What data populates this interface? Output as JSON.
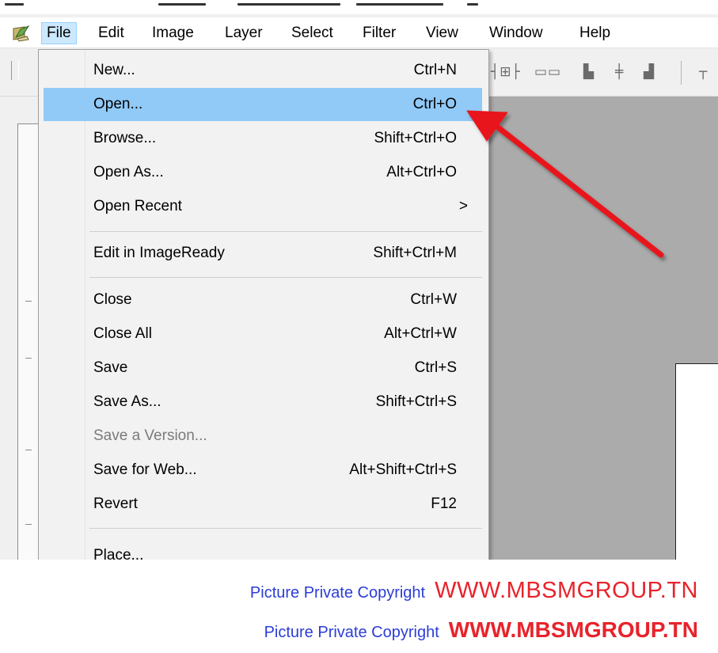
{
  "menubar": {
    "items": [
      "File",
      "Edit",
      "Image",
      "Layer",
      "Select",
      "Filter",
      "View",
      "Window",
      "Help"
    ]
  },
  "file_menu": {
    "items": [
      {
        "label": "New...",
        "shortcut": "Ctrl+N"
      },
      {
        "label": "Open...",
        "shortcut": "Ctrl+O",
        "highlighted": true
      },
      {
        "label": "Browse...",
        "shortcut": "Shift+Ctrl+O"
      },
      {
        "label": "Open As...",
        "shortcut": "Alt+Ctrl+O"
      },
      {
        "label": "Open Recent",
        "submenu_arrow": ">"
      },
      {
        "label": "Edit in ImageReady",
        "shortcut": "Shift+Ctrl+M"
      },
      {
        "label": "Close",
        "shortcut": "Ctrl+W"
      },
      {
        "label": "Close All",
        "shortcut": "Alt+Ctrl+W"
      },
      {
        "label": "Save",
        "shortcut": "Ctrl+S"
      },
      {
        "label": "Save As...",
        "shortcut": "Shift+Ctrl+S"
      },
      {
        "label": "Save a Version...",
        "disabled": true
      },
      {
        "label": "Save for Web...",
        "shortcut": "Alt+Shift+Ctrl+S"
      },
      {
        "label": "Revert",
        "shortcut": "F12"
      },
      {
        "label": "Place..."
      }
    ]
  },
  "watermark": {
    "line1_text": "Picture Private Copyright",
    "line1_url": "WWW.MBSMGROUP.TN",
    "line2_text": "Picture Private Copyright",
    "line2_url": "WWW.MBSMGROUP.TN"
  },
  "colors": {
    "menu_highlight": "#91c9f7",
    "arrow": "#e8141b",
    "watermark_text": "#2b3dd6",
    "watermark_url": "#e8232b"
  },
  "icons": {
    "app": "photoshop-app-icon",
    "arrow": "red-pointer-arrow",
    "submenu": "chevron-right-icon"
  }
}
